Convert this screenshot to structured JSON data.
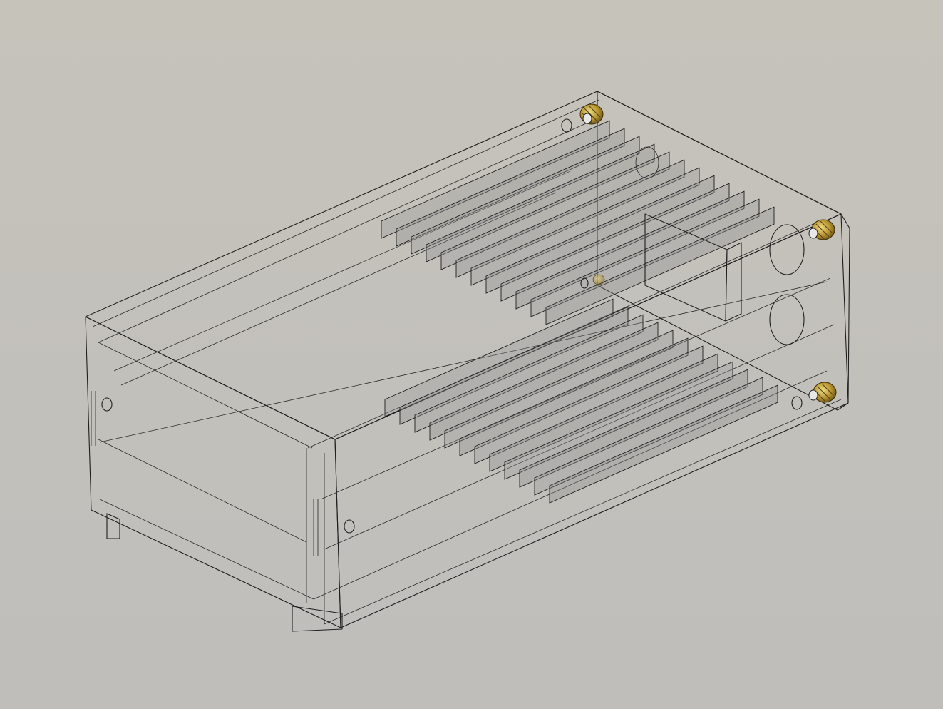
{
  "viewport": {
    "background_top": "#c6c3bb",
    "background_bottom": "#bfbebb"
  },
  "model": {
    "body_color": "#3f3f3f",
    "face_dark": "#4a4a4a",
    "face_mid": "#7a7a7a",
    "face_light": "#9a9a9a",
    "opacity_note_color": "#8f8f8f",
    "insert_color": "#b8962e",
    "insert_highlight": "#e4cc6a",
    "upper_rib_count": 12,
    "lower_rib_count": 12,
    "brass_insert_count": 3,
    "icons": [
      "brass-threaded-insert",
      "mounting-hole",
      "alignment-pin"
    ]
  }
}
